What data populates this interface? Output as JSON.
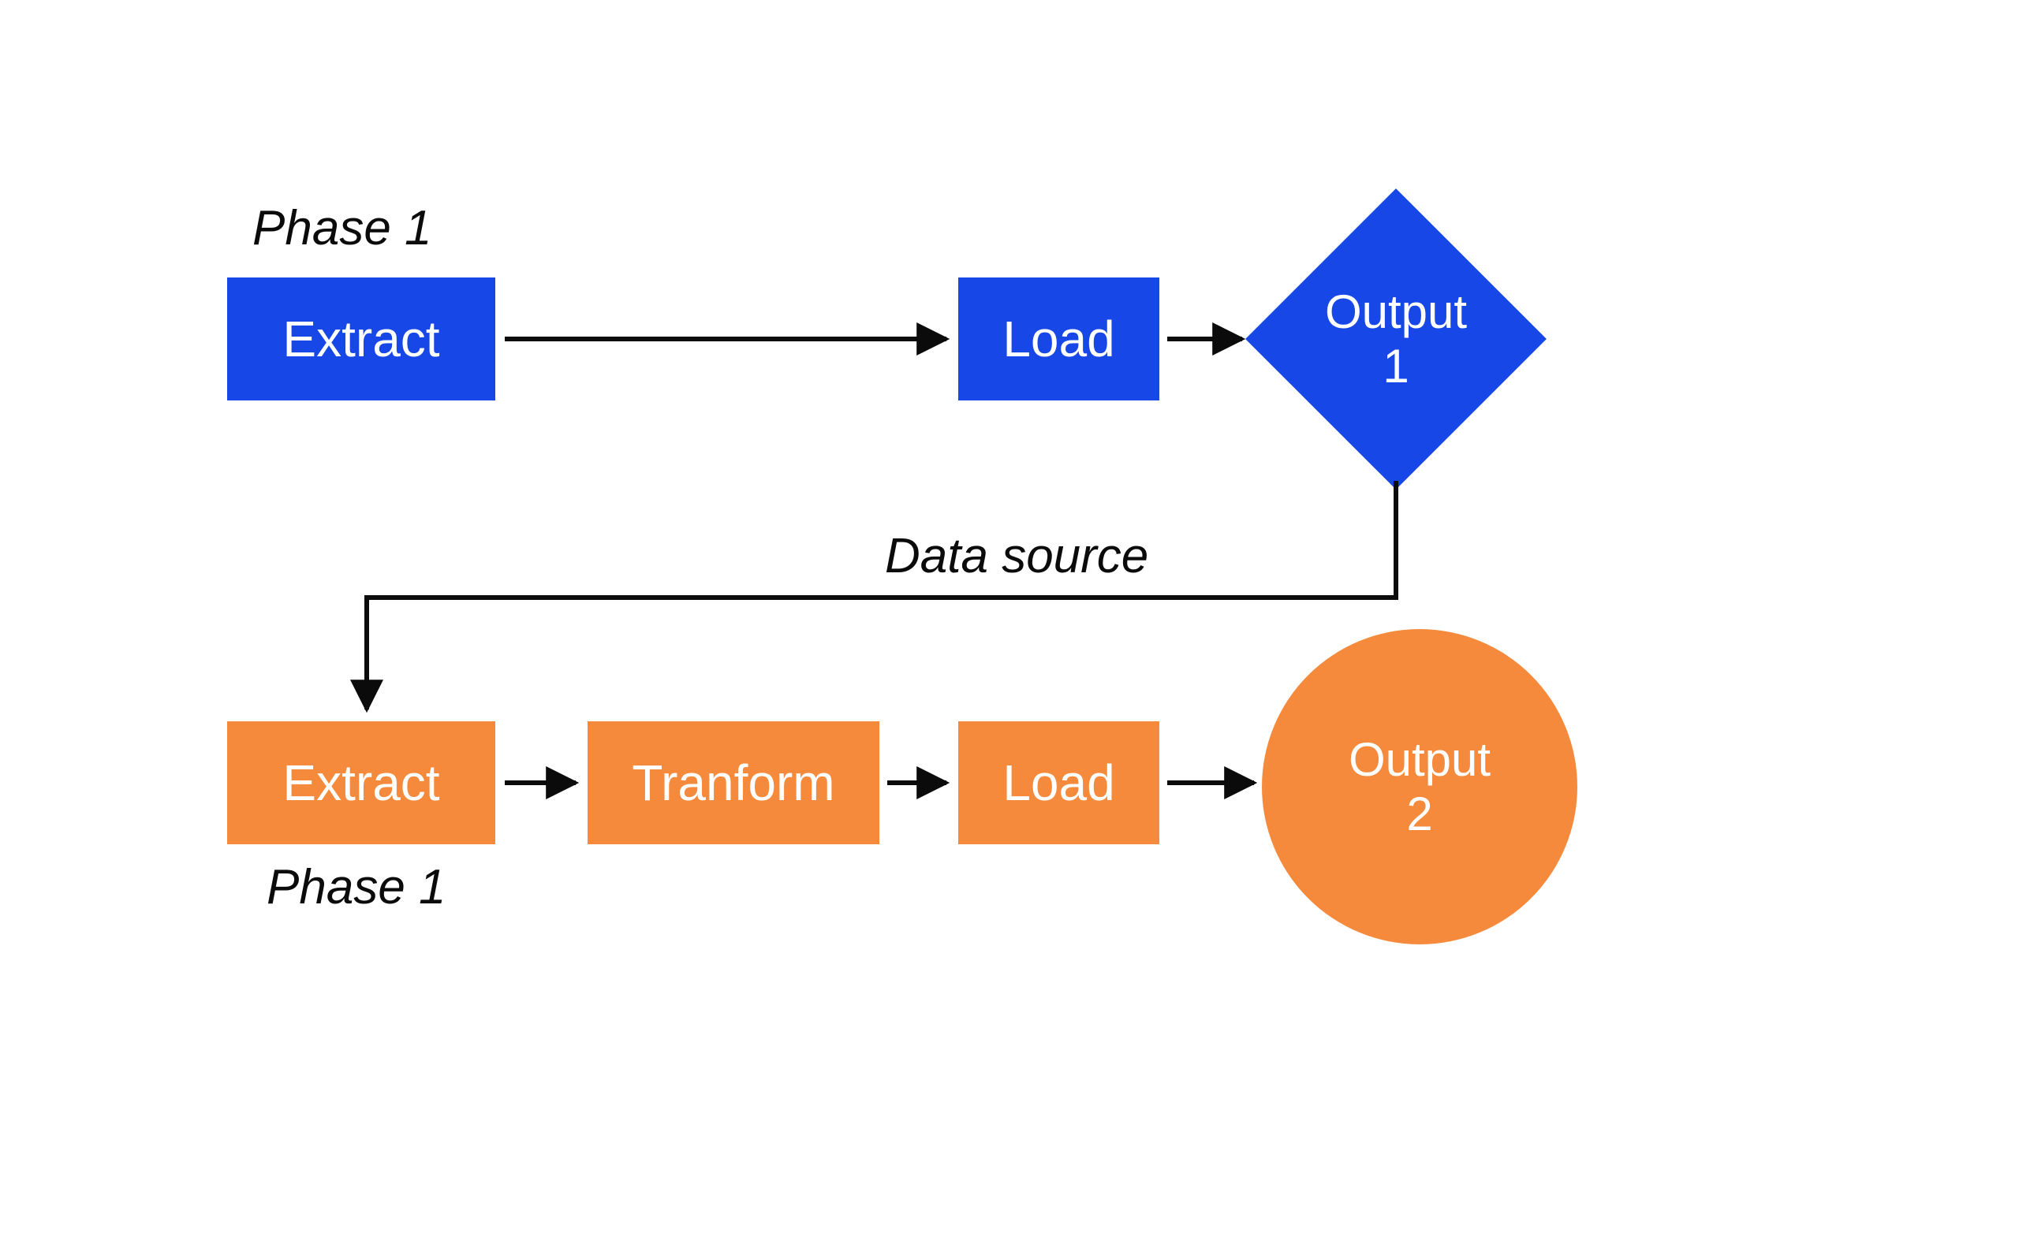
{
  "colors": {
    "blue": "#1747E6",
    "orange": "#F58A3D",
    "text": "#0b0b0b"
  },
  "phase1": {
    "label": "Phase 1",
    "extract": "Extract",
    "load": "Load",
    "output": "Output\n1"
  },
  "connector": {
    "label": "Data source"
  },
  "phase2": {
    "label": "Phase 1",
    "extract": "Extract",
    "transform": "Tranform",
    "load": "Load",
    "output": "Output\n2"
  }
}
